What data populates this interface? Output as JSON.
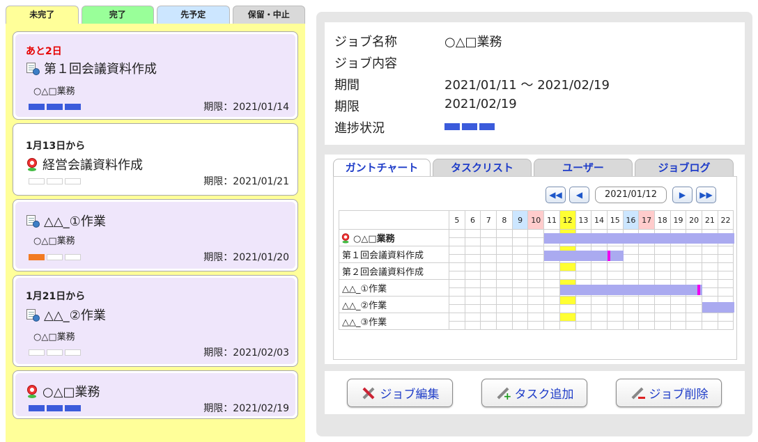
{
  "status_tabs": [
    "未完了",
    "完了",
    "先予定",
    "保留・中止"
  ],
  "jobs": [
    {
      "lead": "あと2日",
      "title": "第１回会議資料作成",
      "sub": "○△□業務",
      "deadline": "期限：2021/01/14"
    },
    {
      "lead": "1月13日から",
      "title": "経営会議資料作成",
      "sub": "",
      "deadline": "期限：2021/01/21"
    },
    {
      "lead": "",
      "title": "△△_①作業",
      "sub": "○△□業務",
      "deadline": "期限：2021/01/20"
    },
    {
      "lead": "1月21日から",
      "title": "△△_②作業",
      "sub": "○△□業務",
      "deadline": "期限：2021/02/03"
    },
    {
      "lead": "",
      "title": "○△□業務",
      "sub": "",
      "deadline": "期限：2021/02/19"
    }
  ],
  "job_progress": [
    [
      1,
      1,
      1
    ],
    [
      0,
      0,
      0
    ],
    [
      0.5,
      0,
      0
    ],
    [
      0,
      0,
      0
    ],
    [
      1,
      1,
      1
    ]
  ],
  "info": {
    "name_label": "ジョブ名称",
    "name_value": "○△□業務",
    "content_label": "ジョブ内容",
    "content_value": "",
    "period_label": "期間",
    "period_value": "2021/01/11 〜 2021/02/19",
    "deadline_label": "期限",
    "deadline_value": "2021/02/19",
    "progress_label": "進捗状況",
    "progress": [
      1,
      1,
      1
    ]
  },
  "view_tabs": [
    "ガントチャート",
    "タスクリスト",
    "ユーザー",
    "ジョブログ"
  ],
  "gantt": {
    "date": "2021/01/12",
    "days": [
      "5",
      "6",
      "7",
      "8",
      "9",
      "10",
      "11",
      "12",
      "13",
      "14",
      "15",
      "16",
      "17",
      "18",
      "19",
      "20",
      "21",
      "22"
    ],
    "rows": [
      "○△□業務",
      "第１回会議資料作成",
      "第２回会議資料作成",
      "△△_①作業",
      "△△_②作業",
      "△△_③作業"
    ]
  },
  "actions": {
    "edit": "ジョブ編集",
    "add": "タスク追加",
    "delete": "ジョブ削除"
  },
  "colors": {
    "accent": "#1e3cc8",
    "progress": "#3b5bdb",
    "bar": "#aaaaf0",
    "marker": "#ee00ee",
    "today": "#ffff33",
    "saturday": "#cce6ff",
    "sunday": "#ffcccc"
  }
}
